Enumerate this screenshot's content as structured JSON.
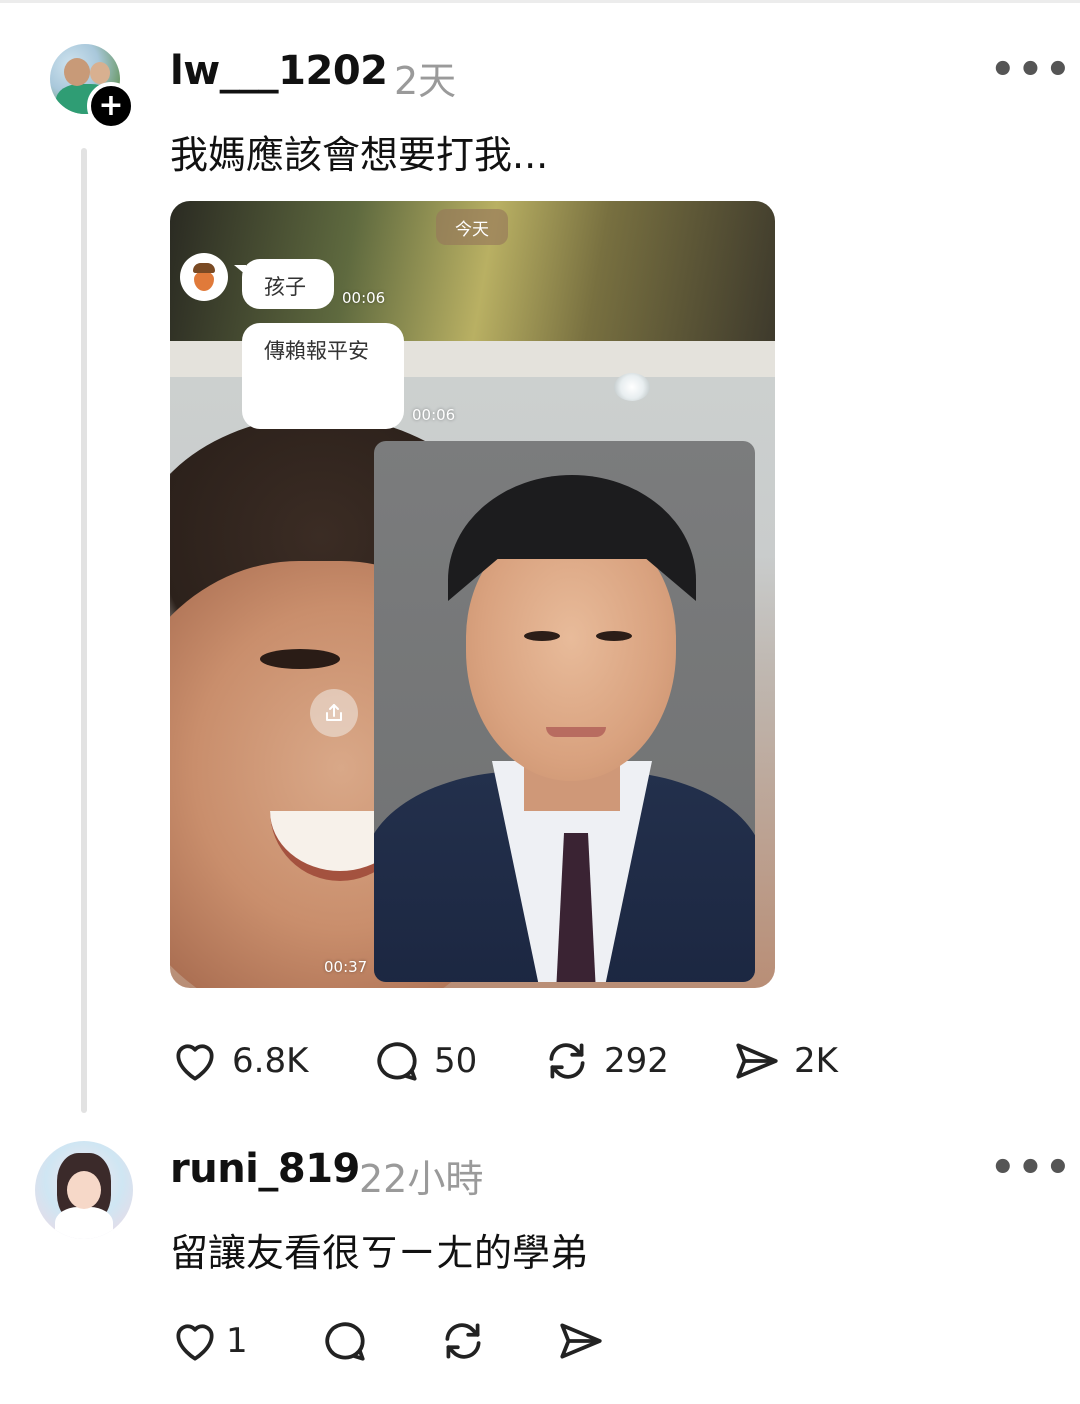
{
  "post": {
    "username": "lw___1202",
    "time": "2天",
    "text": "我媽應該會想要打我...",
    "more": "•••",
    "follow_symbol": "+",
    "media": {
      "date_pill": "今天",
      "bubble1": "孩子",
      "bubble1_time": "00:06",
      "bubble2": "傳賴報平安",
      "bubble2_time": "00:06",
      "video_time": "00:37"
    },
    "actions": {
      "likes": "6.8K",
      "comments": "50",
      "reposts": "292",
      "shares": "2K"
    }
  },
  "reply": {
    "username": "runi_819",
    "time": "22小時",
    "text": "留讓友看很ㄎㄧㄤ的學弟",
    "more": "•••",
    "actions": {
      "likes": "1"
    }
  },
  "icons": [
    "heart-icon",
    "comment-icon",
    "repost-icon",
    "send-icon",
    "share-upload-icon",
    "more-icon",
    "follow-plus-icon"
  ]
}
